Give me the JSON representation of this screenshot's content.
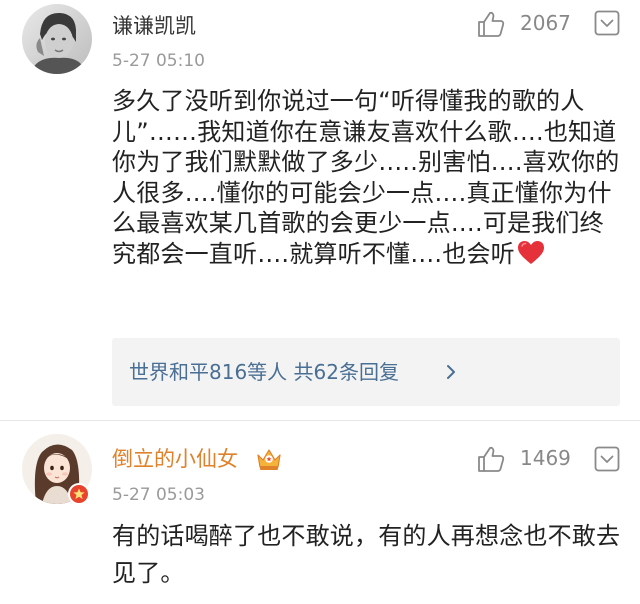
{
  "comments": [
    {
      "author": "谦谦凯凯",
      "time": "5-27 05:10",
      "likes": "2067",
      "text": "多久了没听到你说过一句“听得懂我的歌的人儿”……我知道你在意谦友喜欢什么歌….也知道你为了我们默默做了多少…..别害怕….喜欢你的人很多….懂你的可能会少一点….真正懂你为什么最喜欢某几首歌的会更少一点….可是我们终究都会一直听….就算听不懂….也会听",
      "reply_summary": "世界和平816等人 共62条回复",
      "icons": [
        "avatar",
        "thumbs-up-icon",
        "menu-down-icon",
        "red-heart-emoji",
        "chevron-right-icon"
      ]
    },
    {
      "author": "倒立的小仙女",
      "time": "5-27 05:03",
      "likes": "1469",
      "text": "有的话喝醉了也不敢说，有的人再想念也不敢去见了。",
      "icons": [
        "avatar",
        "vip-crown-badge",
        "verified-badge",
        "thumbs-up-icon",
        "menu-down-icon"
      ]
    }
  ],
  "colors": {
    "author_default": "#333333",
    "author_vip": "#e0822c",
    "link_blue": "#4a6f94",
    "meta_gray": "#9a9a9a",
    "reply_bg": "#f3f3f3",
    "heart_red": "#e5323a"
  }
}
